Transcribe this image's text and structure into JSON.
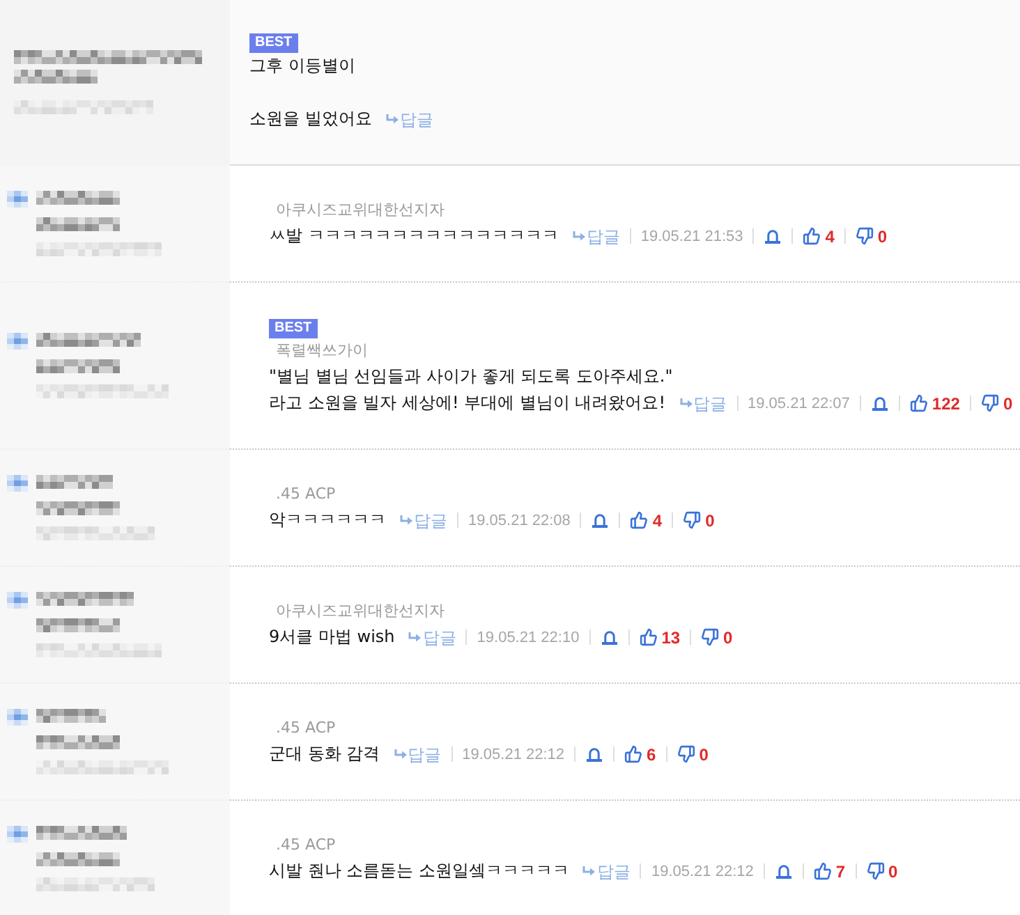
{
  "comments": [
    {
      "kind": "comment",
      "badge": "BEST",
      "paragraphs": [
        [
          "그후 이등별이"
        ],
        [
          "소원을 빌었어요"
        ]
      ],
      "reply_link": "답글"
    },
    {
      "kind": "reply",
      "author": "아쿠시즈교위대한선지자",
      "paragraphs": [
        [
          "ㅆ발 ㅋㅋㅋㅋㅋㅋㅋㅋㅋㅋㅋㅋㅋㅋㅋ"
        ]
      ],
      "reply_link": "답글",
      "date": "19.05.21 21:53",
      "likes": "4",
      "dislikes": "0"
    },
    {
      "kind": "reply",
      "badge": "BEST",
      "author": "폭렬쌕쓰가이",
      "paragraphs": [
        [
          "\"별님 별님 선임들과 사이가 좋게 되도록 도아주세요.\"",
          "라고 소원을 빌자 세상에! 부대에 별님이 내려왔어요!"
        ]
      ],
      "reply_link": "답글",
      "date": "19.05.21 22:07",
      "likes": "122",
      "dislikes": "0"
    },
    {
      "kind": "reply",
      "author": ".45 ACP",
      "paragraphs": [
        [
          "악ㅋㅋㅋㅋㅋㅋ"
        ]
      ],
      "reply_link": "답글",
      "date": "19.05.21 22:08",
      "likes": "4",
      "dislikes": "0"
    },
    {
      "kind": "reply",
      "author": "아쿠시즈교위대한선지자",
      "paragraphs": [
        [
          "9서클 마법 wish"
        ]
      ],
      "reply_link": "답글",
      "date": "19.05.21 22:10",
      "likes": "13",
      "dislikes": "0"
    },
    {
      "kind": "reply",
      "author": ".45 ACP",
      "paragraphs": [
        [
          "군대 동화 감격"
        ]
      ],
      "reply_link": "답글",
      "date": "19.05.21 22:12",
      "likes": "6",
      "dislikes": "0"
    },
    {
      "kind": "reply",
      "author": ".45 ACP",
      "paragraphs": [
        [
          "시발 줜나 소름돋는 소원일셐ㅋㅋㅋㅋㅋ"
        ]
      ],
      "reply_link": "답글",
      "date": "19.05.21 22:12",
      "likes": "7",
      "dislikes": "0"
    }
  ]
}
